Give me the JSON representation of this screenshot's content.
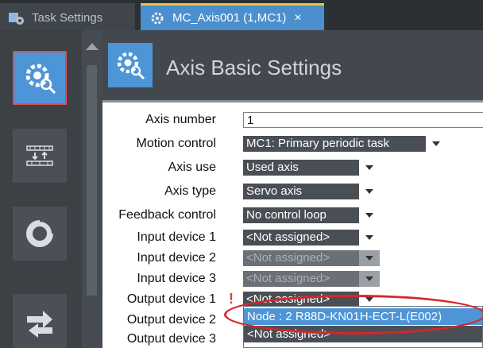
{
  "tabs": [
    {
      "label": "Task Settings",
      "icon": "task-settings-icon",
      "active": false
    },
    {
      "label": "MC_Axis001 (1,MC1)",
      "icon": "axis-gear-icon",
      "active": true,
      "close": "×"
    }
  ],
  "toolbar": [
    {
      "icon": "axis-basic-settings-icon",
      "active": true
    },
    {
      "icon": "unit-conversion-icon",
      "active": false
    },
    {
      "icon": "operation-settings-icon",
      "active": false
    },
    {
      "icon": "transfer-arrows-icon",
      "active": false
    }
  ],
  "page": {
    "title": "Axis Basic Settings",
    "icon": "axis-gear-icon"
  },
  "fields": [
    {
      "label": "Axis number",
      "value": "1",
      "kind": "text"
    },
    {
      "label": "Motion control",
      "value": "MC1: Primary periodic task",
      "kind": "select"
    },
    {
      "label": "Axis use",
      "value": "Used axis",
      "kind": "select"
    },
    {
      "label": "Axis type",
      "value": "Servo axis",
      "kind": "select"
    },
    {
      "label": "Feedback control",
      "value": "No control loop",
      "kind": "select"
    },
    {
      "label": "Input device 1",
      "value": "<Not assigned>",
      "kind": "select"
    },
    {
      "label": "Input device 2",
      "value": "<Not assigned>",
      "kind": "select",
      "disabled": true
    },
    {
      "label": "Input device 3",
      "value": "<Not assigned>",
      "kind": "select",
      "disabled": true
    },
    {
      "label": "Output device 1",
      "value": "<Not assigned>",
      "kind": "select",
      "warning": "!"
    },
    {
      "label": "Output device 2",
      "value": "",
      "kind": "select"
    },
    {
      "label": "Output device 3",
      "value": "",
      "kind": "select"
    }
  ],
  "dropdown": {
    "options": [
      "Node : 2 R88D-KN01H-ECT-L(E002)",
      "<Not assigned>"
    ],
    "selected": "Node : 2 R88D-KN01H-ECT-L(E002)"
  },
  "colors": {
    "accent": "#4d95d6",
    "highlight": "#d6262c",
    "active_tab_top": "#f0c23b"
  }
}
